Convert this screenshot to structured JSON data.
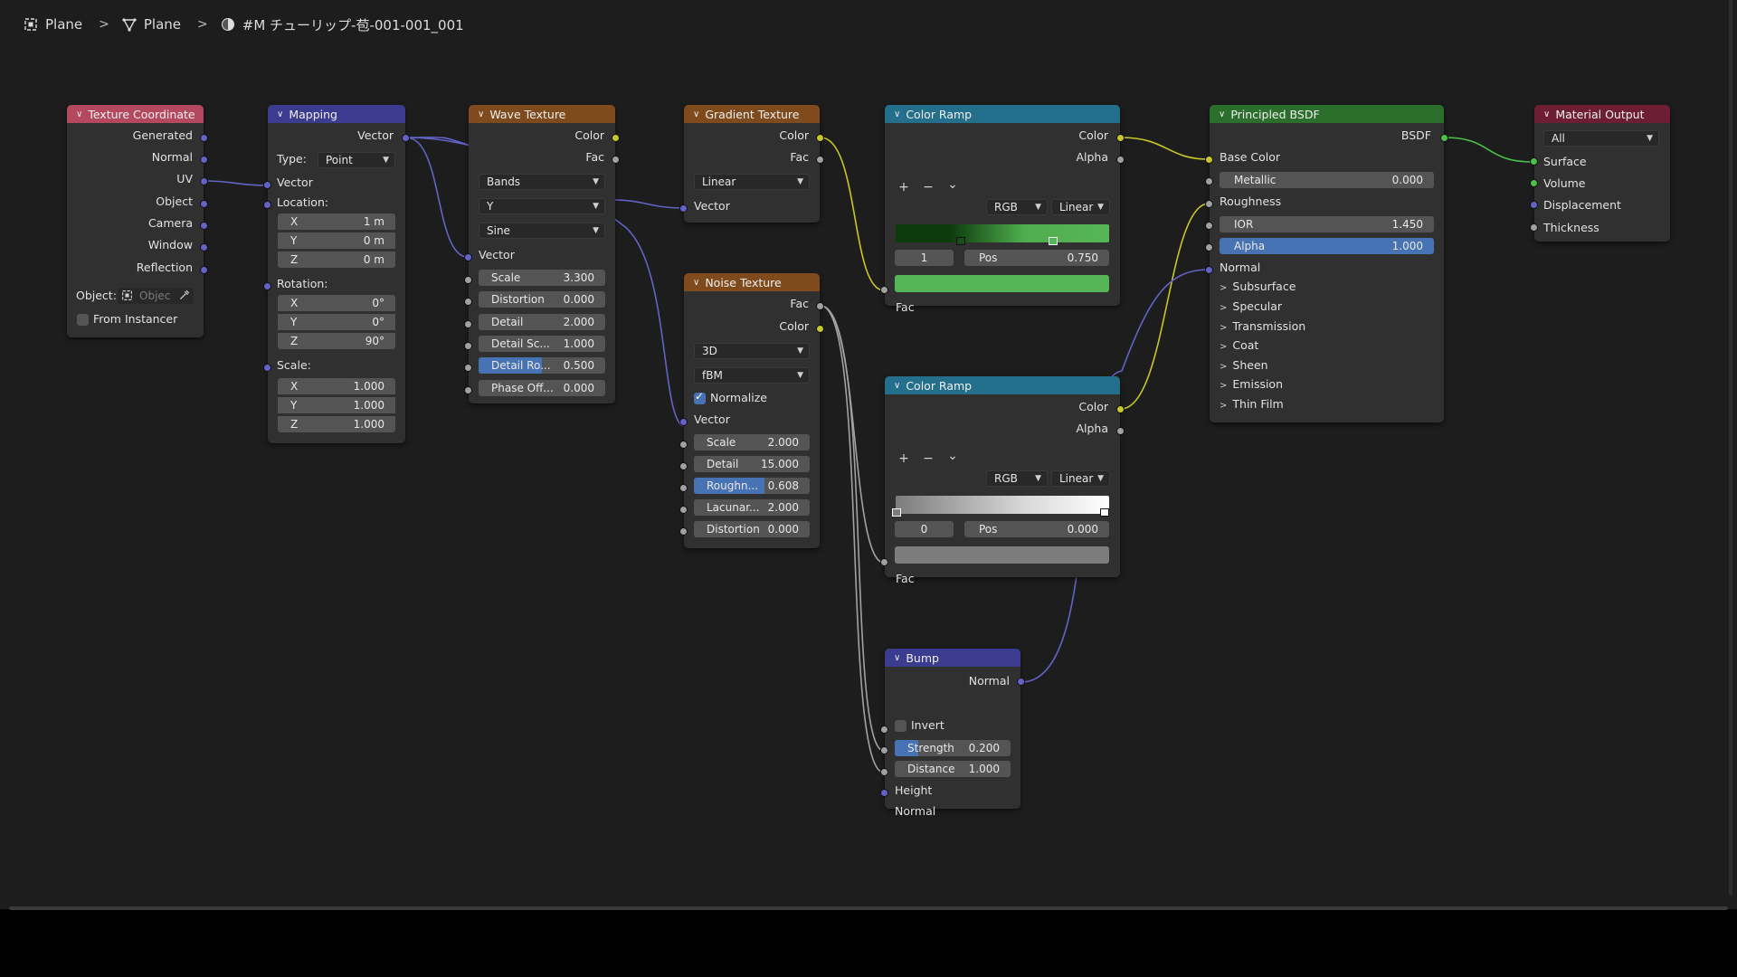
{
  "breadcrumb": {
    "item1": "Plane",
    "item2": "Plane",
    "item3": "#M チューリップ-苞-001-001_001"
  },
  "colors": {
    "texture_header": "#b4485e",
    "vector_header": "#3b3b8f",
    "tex_header": "#7f4a1c",
    "converter_header": "#236f8c",
    "shader_header": "#2c6e2c",
    "output_header": "#6e1e34"
  },
  "tex_coord": {
    "title": "Texture Coordinate",
    "outputs": [
      "Generated",
      "Normal",
      "UV",
      "Object",
      "Camera",
      "Window",
      "Reflection"
    ],
    "object_label": "Object:",
    "object_placeholder": "Objec",
    "from_instancer": "From Instancer"
  },
  "mapping": {
    "title": "Mapping",
    "out_vector": "Vector",
    "type_label": "Type:",
    "type_value": "Point",
    "in_vector": "Vector",
    "location_label": "Location:",
    "rotation_label": "Rotation:",
    "scale_label": "Scale:",
    "loc": [
      {
        "a": "X",
        "v": "1 m"
      },
      {
        "a": "Y",
        "v": "0 m"
      },
      {
        "a": "Z",
        "v": "0 m"
      }
    ],
    "rot": [
      {
        "a": "X",
        "v": "0°"
      },
      {
        "a": "Y",
        "v": "0°"
      },
      {
        "a": "Z",
        "v": "90°"
      }
    ],
    "scl": [
      {
        "a": "X",
        "v": "1.000"
      },
      {
        "a": "Y",
        "v": "1.000"
      },
      {
        "a": "Z",
        "v": "1.000"
      }
    ]
  },
  "wave": {
    "title": "Wave Texture",
    "out_color": "Color",
    "out_fac": "Fac",
    "wave_type": "Bands",
    "direction": "Y",
    "profile": "Sine",
    "in_vector": "Vector",
    "fields": [
      {
        "label": "Scale",
        "value": "3.300",
        "fill": 0
      },
      {
        "label": "Distortion",
        "value": "0.000",
        "fill": 0
      },
      {
        "label": "Detail",
        "value": "2.000",
        "fill": 0
      },
      {
        "label": "Detail Sc...",
        "value": "1.000",
        "fill": 0
      },
      {
        "label": "Detail Ro...",
        "value": "0.500",
        "fill": 0.5
      },
      {
        "label": "Phase Off...",
        "value": "0.000",
        "fill": 0
      }
    ]
  },
  "gradient": {
    "title": "Gradient Texture",
    "out_color": "Color",
    "out_fac": "Fac",
    "type": "Linear",
    "in_vector": "Vector"
  },
  "noise": {
    "title": "Noise Texture",
    "out_fac": "Fac",
    "out_color": "Color",
    "dims": "3D",
    "type": "fBM",
    "normalize": "Normalize",
    "in_vector": "Vector",
    "fields": [
      {
        "label": "Scale",
        "value": "2.000",
        "fill": 0
      },
      {
        "label": "Detail",
        "value": "15.000",
        "fill": 0
      },
      {
        "label": "Roughn...",
        "value": "0.608",
        "fill": 0.608
      },
      {
        "label": "Lacunar...",
        "value": "2.000",
        "fill": 0
      },
      {
        "label": "Distortion",
        "value": "0.000",
        "fill": 0
      }
    ]
  },
  "ramp1": {
    "title": "Color Ramp",
    "out_color": "Color",
    "out_alpha": "Alpha",
    "add": "+",
    "remove": "−",
    "menu": "⌄",
    "color_mode": "RGB",
    "interp": "Linear",
    "index": "1",
    "pos_label": "Pos",
    "pos_value": "0.750",
    "in_fac": "Fac",
    "stop_color": "#56b556"
  },
  "ramp2": {
    "title": "Color Ramp",
    "out_color": "Color",
    "out_alpha": "Alpha",
    "add": "+",
    "remove": "−",
    "menu": "⌄",
    "color_mode": "RGB",
    "interp": "Linear",
    "index": "0",
    "pos_label": "Pos",
    "pos_value": "0.000",
    "in_fac": "Fac",
    "stop_color": "#7c7c7c"
  },
  "bump": {
    "title": "Bump",
    "out_normal": "Normal",
    "invert": "Invert",
    "fields": [
      {
        "label": "Strength",
        "value": "0.200",
        "fill": 0.2
      },
      {
        "label": "Distance",
        "value": "1.000",
        "fill": 0
      }
    ],
    "in_height": "Height",
    "in_normal": "Normal"
  },
  "bsdf": {
    "title": "Principled BSDF",
    "out_bsdf": "BSDF",
    "base_color": "Base Color",
    "metallic": {
      "label": "Metallic",
      "value": "0.000"
    },
    "roughness": "Roughness",
    "ior": {
      "label": "IOR",
      "value": "1.450"
    },
    "alpha": {
      "label": "Alpha",
      "value": "1.000"
    },
    "normal": "Normal",
    "panels": [
      "Subsurface",
      "Specular",
      "Transmission",
      "Coat",
      "Sheen",
      "Emission",
      "Thin Film"
    ]
  },
  "output": {
    "title": "Material Output",
    "target": "All",
    "inputs": [
      "Surface",
      "Volume",
      "Displacement",
      "Thickness"
    ]
  }
}
